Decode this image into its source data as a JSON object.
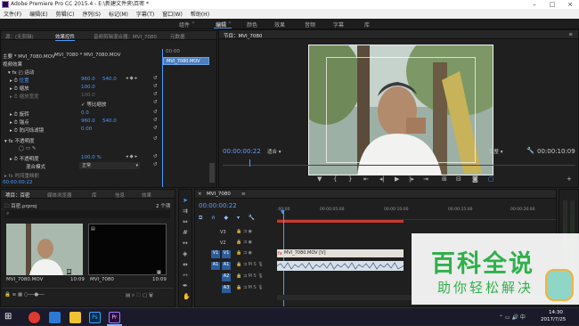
{
  "window": {
    "title": "Adobe Premiere Pro CC 2015.4 - E:\\新建文件夹\\百密 *"
  },
  "menu": [
    "文件(F)",
    "编辑(E)",
    "剪辑(C)",
    "序列(S)",
    "标记(M)",
    "字幕(T)",
    "窗口(W)",
    "帮助(H)"
  ],
  "workspaces": [
    "组件",
    "编辑",
    "颜色",
    "效果",
    "音频",
    "字幕",
    "库"
  ],
  "effect_controls": {
    "tabs": [
      "源：(无剪辑)",
      "效果控件",
      "音频剪辑混合器：MVI_7080",
      "元数据"
    ],
    "master": "主要 * MVI_7080.MOV",
    "clip": "MVI_7080 * MVI_7080.MOV",
    "time_start": "00:00",
    "clip_bar": "MVI_7080.MOV",
    "video_effects": "视频效果",
    "motion": "运动",
    "position_label": "位置",
    "position_x": "960.0",
    "position_y": "540.0",
    "scale_label": "缩放",
    "scale_val": "100.0",
    "scale_width_label": "缩放宽度",
    "scale_width_val": "100.0",
    "uniform_scale": "等比缩放",
    "rotation_label": "旋转",
    "rotation_val": "0.0",
    "anchor_label": "锚点",
    "anchor_x": "960.0",
    "anchor_y": "540.0",
    "flicker_label": "防闪烁滤镜",
    "flicker_val": "0.00",
    "opacity": "不透明度",
    "opacity_label": "不透明度",
    "opacity_val": "100.0 %",
    "blend_label": "混合模式",
    "blend_val": "正常",
    "timecode": "00:00:00:22"
  },
  "program": {
    "title": "节目：MVI_7080",
    "timecode": "00:00:00:22",
    "fit": "适合",
    "quality": "完整",
    "duration": "00:00:10:09"
  },
  "project": {
    "tabs": [
      "项目：百密",
      "媒体浏览器",
      "库",
      "信息",
      "效果"
    ],
    "path": "百密.prproj",
    "item_count": "2 个项",
    "items": [
      {
        "name": "MVI_7080.MOV",
        "duration": "10:09"
      },
      {
        "name": "MVI_7080",
        "duration": "10:09"
      }
    ]
  },
  "timeline": {
    "sequence": "MVI_7080",
    "timecode": "00:00:00:22",
    "ruler": [
      ":00:00",
      "00:00:05:00",
      "00:00:10:00",
      "00:00:15:00",
      "00:00:20:00"
    ],
    "tracks": [
      "V3",
      "V2",
      "V1",
      "A1",
      "A2",
      "A3"
    ],
    "video_clip": "MVI_7080.MOV [V]"
  },
  "watermark": {
    "line1": "百科全说",
    "line2": "助你轻松解决"
  },
  "taskbar": {
    "time": "14:30",
    "date": "2017/7/25"
  },
  "colors": {
    "accent": "#4d9bff",
    "premiere": "#9a7bff",
    "clip_video": "#e4e0da",
    "clip_audio": "#d7dfe9"
  }
}
